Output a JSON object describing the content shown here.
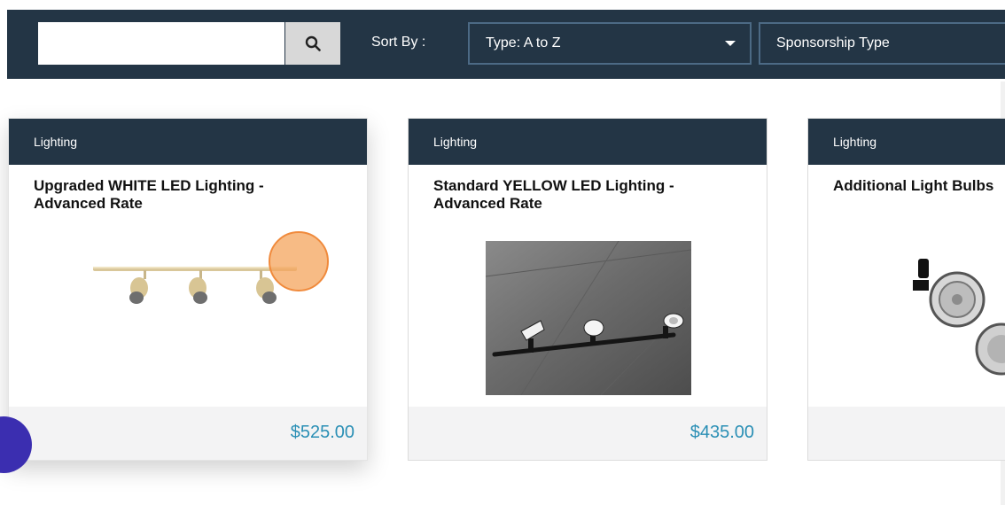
{
  "toolbar": {
    "search": {
      "value": "",
      "placeholder": ""
    },
    "search_icon": "search-icon",
    "sort_label": "Sort By :",
    "sort_select": {
      "selected": "Type: A to Z"
    },
    "sponsorship_select": {
      "selected": "Sponsorship Type"
    }
  },
  "cards": [
    {
      "category": "Lighting",
      "title": "Upgraded WHITE LED Lighting - Advanced Rate",
      "price": "$525.00",
      "image": "track-light-rail-white"
    },
    {
      "category": "Lighting",
      "title": "Standard YELLOW LED Lighting - Advanced Rate",
      "price": "$435.00",
      "image": "track-light-rail-on-concrete-floor"
    },
    {
      "category": "Lighting",
      "title": "Additional Light Bulbs",
      "price": "",
      "image": "clip-on-light-bulbs"
    }
  ],
  "colors": {
    "header": "#233545",
    "price": "#2a8fb5",
    "select_border": "#4c6a85",
    "highlight": "#f4a45c",
    "chat_bubble": "#3b2eb0"
  }
}
